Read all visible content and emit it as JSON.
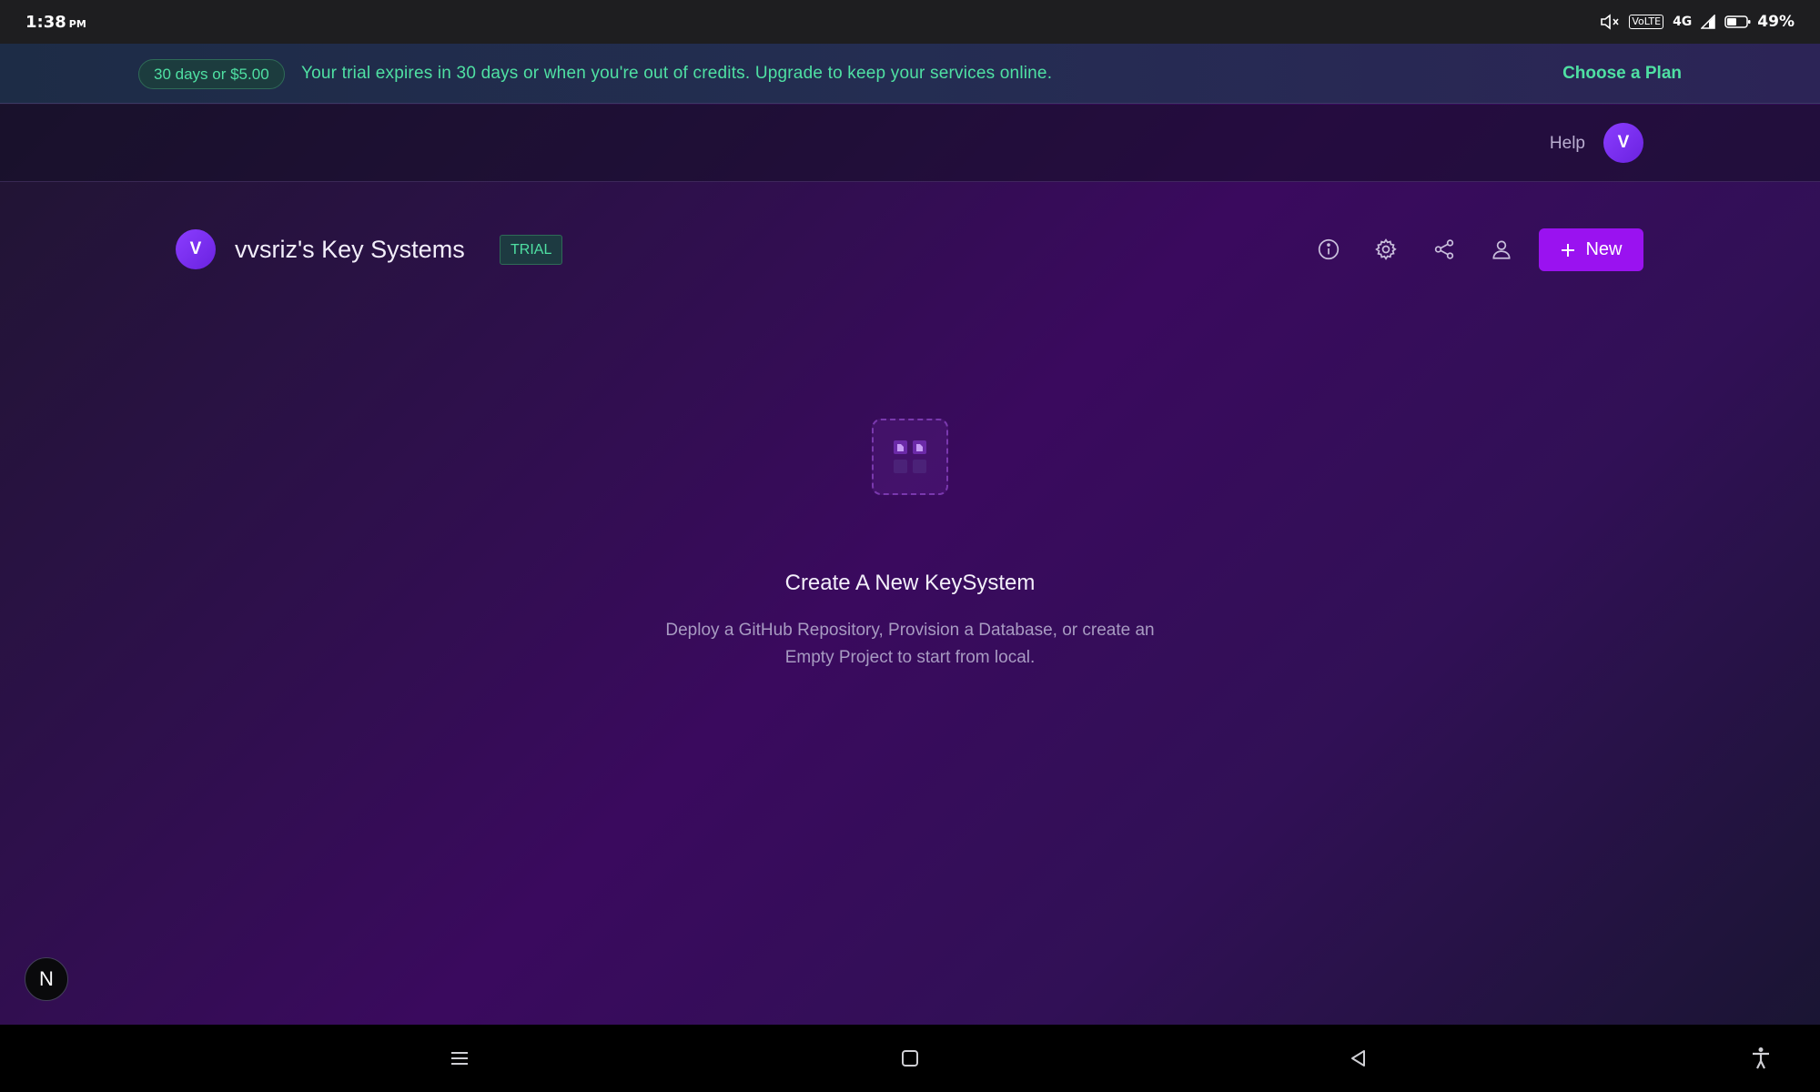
{
  "status_bar": {
    "time": "1:38",
    "time_suffix": "PM",
    "volte": "VoLTE",
    "network": "4G",
    "battery": "49%"
  },
  "banner": {
    "pill": "30 days or $5.00",
    "message": "Your trial expires in 30 days or when you're out of credits. Upgrade to keep your services online.",
    "cta": "Choose a Plan"
  },
  "header": {
    "help": "Help",
    "avatar_initial": "V"
  },
  "project": {
    "avatar_initial": "V",
    "title": "vvsriz's Key Systems",
    "badge": "TRIAL",
    "actions": [
      "info-icon",
      "settings-icon",
      "share-icon",
      "members-icon"
    ],
    "new_button": "New"
  },
  "empty_state": {
    "title": "Create A New KeySystem",
    "description_line1": "Deploy a GitHub Repository, Provision a Database, or create an",
    "description_line2": "Empty Project to start from local."
  },
  "floating_badge": "N",
  "colors": {
    "accent": "#9a12f0",
    "success_text": "#4fe0a3",
    "avatar": "#7b2ff7"
  }
}
